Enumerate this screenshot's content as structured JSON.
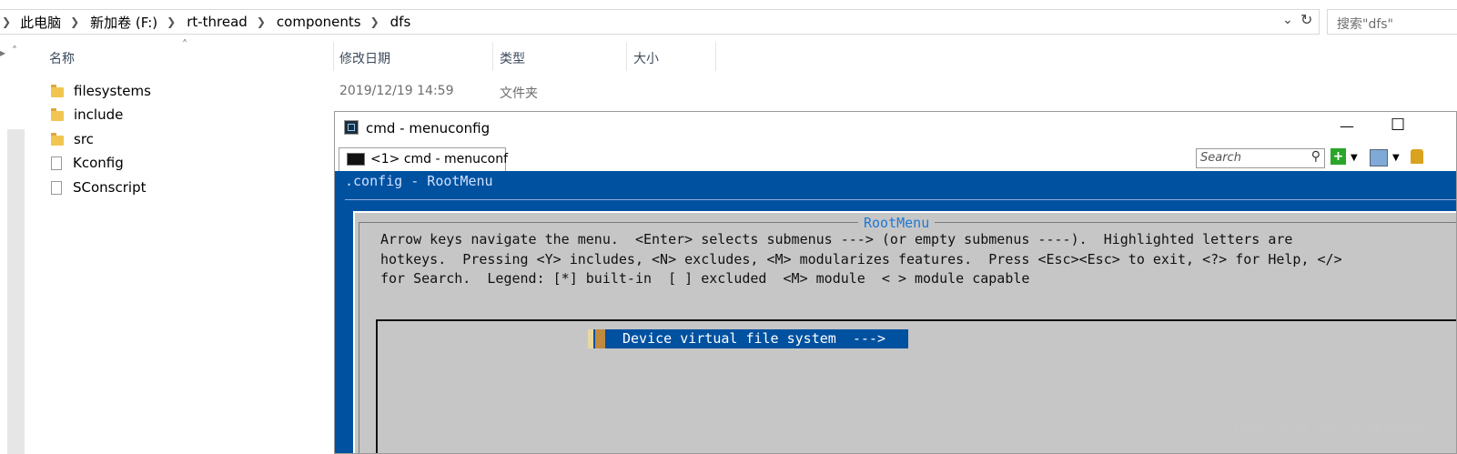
{
  "explorer": {
    "breadcrumb": [
      "此电脑",
      "新加卷 (F:)",
      "rt-thread",
      "components",
      "dfs"
    ],
    "search_placeholder": "搜索\"dfs\"",
    "columns": {
      "name": "名称",
      "date": "修改日期",
      "type": "类型",
      "size": "大小"
    },
    "files": [
      {
        "name": "filesystems",
        "kind": "folder",
        "date": "2019/12/19 14:59",
        "type": "文件夹"
      },
      {
        "name": "include",
        "kind": "folder"
      },
      {
        "name": "src",
        "kind": "folder"
      },
      {
        "name": "Kconfig",
        "kind": "file"
      },
      {
        "name": "SConscript",
        "kind": "file"
      }
    ]
  },
  "cmd": {
    "title": "cmd - menuconfig",
    "tab_label": "<1> cmd - menuconf",
    "search_placeholder": "Search",
    "config_title": ".config - RootMenu",
    "dialog_title": "RootMenu",
    "help_lines": [
      "Arrow keys navigate the menu.  <Enter> selects submenus ---> (or empty submenus ----).  Highlighted letters are",
      "hotkeys.  Pressing <Y> includes, <N> excludes, <M> modularizes features.  Press <Esc><Esc> to exit, <?> for Help, </>",
      "for Search.  Legend: [*] built-in  [ ] excluded  <M> module  < > module capable"
    ],
    "menu_items": [
      {
        "label": "Device virtual file system  --->",
        "selected": true
      }
    ],
    "colors": {
      "terminal_bg": "#0051a0",
      "dialog_bg": "#c6c6c6",
      "title_accent": "#1f78d6"
    }
  },
  "watermark": "https://blog.csdn.net/guangod"
}
